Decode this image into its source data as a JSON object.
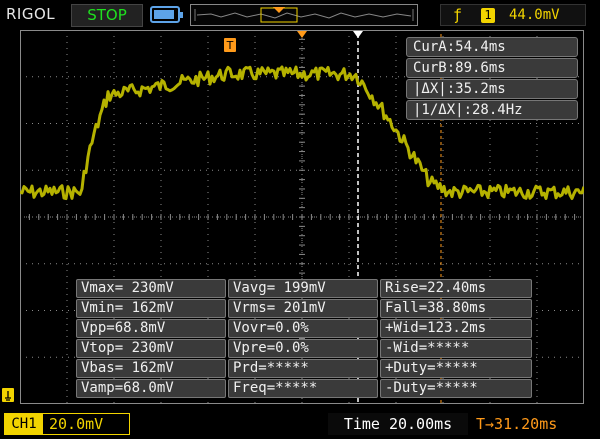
{
  "header": {
    "brand": "RIGOL",
    "run_state": "STOP",
    "trigger_edge_icon": "rising-edge-icon",
    "trigger_source": "1",
    "trigger_level": "44.0mV"
  },
  "colors": {
    "trace": "#b5b200",
    "grid": "#8a8a8a",
    "trigger": "#f2d400",
    "cursor_b": "#ff9a1a",
    "run_state": "#1fe01f",
    "battery": "#5da3e8"
  },
  "cursors": {
    "rows": [
      "CurA:54.4ms",
      "CurB:89.6ms",
      "|ΔX|:35.2ms",
      "|1/ΔX|:28.4Hz"
    ]
  },
  "measurements": {
    "col1": [
      "Vmax= 230mV",
      "Vmin= 162mV",
      "Vpp=68.8mV",
      "Vtop= 230mV",
      "Vbas= 162mV",
      "Vamp=68.0mV"
    ],
    "col2": [
      "Vavg= 199mV",
      "Vrms= 201mV",
      "Vovr=0.0%",
      "Vpre=0.0%",
      "Prd=*****",
      "Freq=*****"
    ],
    "col3": [
      "Rise=22.40ms",
      "Fall=38.80ms",
      "+Wid=123.2ms",
      "-Wid=*****",
      "+Duty=*****",
      "-Duty=*****"
    ]
  },
  "footer": {
    "channel": "CH1",
    "channel_scale": "20.0mV",
    "timebase": "Time 20.00ms",
    "trigger_offset": "T→31.20ms"
  },
  "waveform": {
    "low_level_mV": 162,
    "high_level_mV": 230
  }
}
